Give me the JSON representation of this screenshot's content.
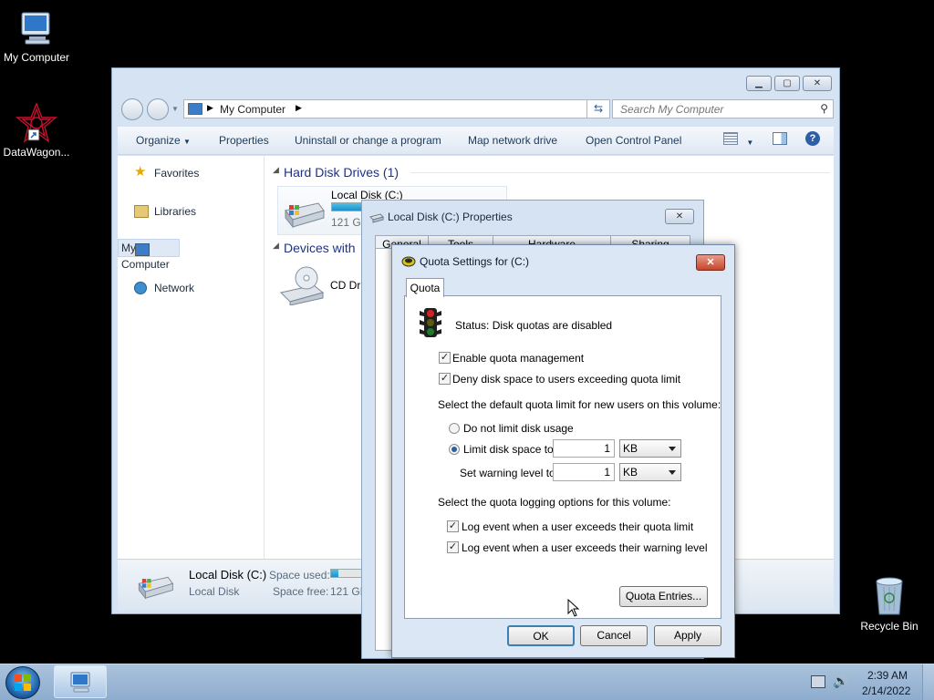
{
  "desktop": {
    "icons": [
      {
        "label": "My Computer"
      },
      {
        "label": "DataWagon..."
      },
      {
        "label": "Recycle Bin"
      }
    ]
  },
  "explorer": {
    "address": [
      "My Computer"
    ],
    "search_placeholder": "Search My Computer",
    "commands": {
      "organize": "Organize",
      "properties": "Properties",
      "uninstall": "Uninstall or change a program",
      "map_drive": "Map network drive",
      "control_panel": "Open Control Panel"
    },
    "nav": {
      "favorites": "Favorites",
      "libraries": "Libraries",
      "my_computer": "My Computer",
      "network": "Network"
    },
    "groups": {
      "hdd": "Hard Disk Drives (1)",
      "devices": "Devices with"
    },
    "items": {
      "local_disk": "Local Disk (C:)",
      "local_disk_size": "121 GB",
      "cd_drive": "CD Dri"
    },
    "details": {
      "name": "Local Disk (C:)",
      "type": "Local Disk",
      "space_used_label": "Space used:",
      "space_free_label": "Space free:",
      "space_free_value": "121 GB"
    }
  },
  "properties": {
    "title": "Local Disk (C:) Properties",
    "tabs": [
      "General",
      "Tools",
      "Hardware",
      "Sharing"
    ]
  },
  "quota": {
    "title": "Quota Settings for  (C:)",
    "tab": "Quota",
    "status": "Status:  Disk quotas are disabled",
    "enable": "Enable quota management",
    "enable_checked": true,
    "deny": "Deny disk space to users exceeding quota limit",
    "deny_checked": true,
    "default_limit_label": "Select the default quota limit for new users on this volume:",
    "no_limit": "Do not limit disk usage",
    "limit_to": "Limit disk space to",
    "limit_value": "1",
    "limit_unit": "KB",
    "warning_label": "Set warning level to",
    "warning_value": "1",
    "warning_unit": "KB",
    "logging_label": "Select the quota logging options for this volume:",
    "log_limit": "Log event when a user exceeds their quota limit",
    "log_limit_checked": true,
    "log_warning": "Log event when a user exceeds their warning level",
    "log_warning_checked": true,
    "entries_button": "Quota Entries...",
    "ok": "OK",
    "cancel": "Cancel",
    "apply": "Apply"
  },
  "taskbar": {
    "time": "2:39 AM",
    "date": "2/14/2022"
  }
}
